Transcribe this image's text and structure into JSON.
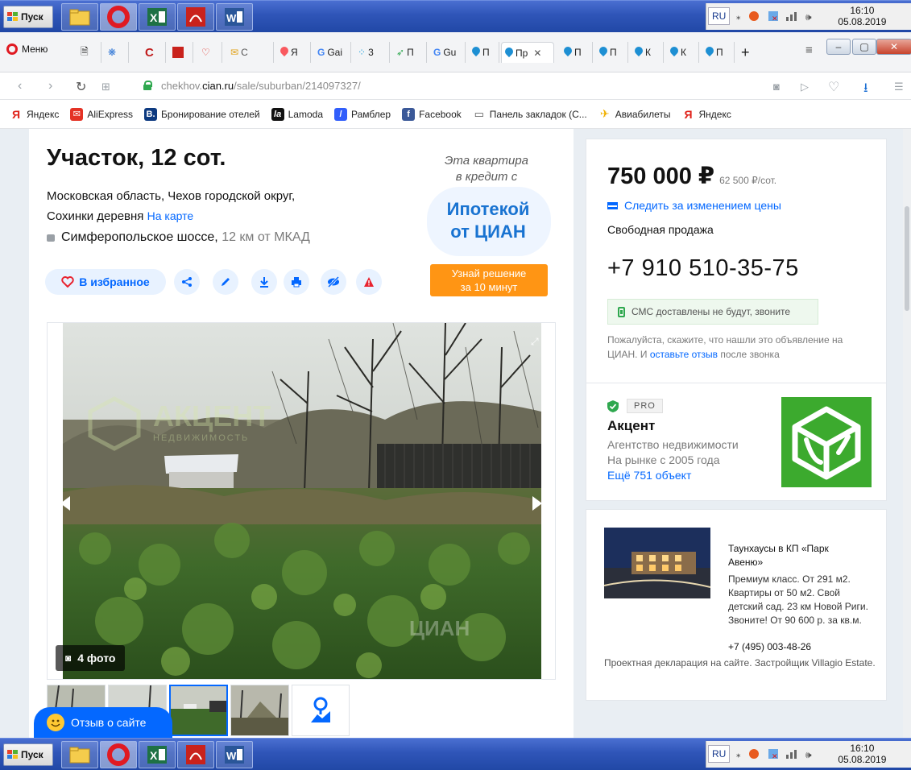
{
  "taskbar": {
    "start_label": "Пуск",
    "lang": "RU",
    "time": "16:10",
    "date": "05.08.2019"
  },
  "browser": {
    "menu_label": "Меню",
    "tabs": [
      "С",
      "Я",
      "Gai",
      "3",
      "П",
      "Gu",
      "П",
      "Пр",
      "П",
      "П",
      "К",
      "К",
      "П"
    ],
    "new_tab": "+",
    "url_prefix": "chekhov.",
    "url_domain": "cian.ru",
    "url_path": "/sale/suburban/214097327/"
  },
  "bookmarks": [
    {
      "label": "Яндекс",
      "icon": "Я",
      "color": "#e0231b"
    },
    {
      "label": "AliExpress",
      "icon": "✉",
      "color": "#e43225"
    },
    {
      "label": "Бронирование отелей",
      "icon": "B.",
      "color": "#0d3a80"
    },
    {
      "label": "Lamoda",
      "icon": "la",
      "color": "#111111"
    },
    {
      "label": "Рамблер",
      "icon": "/",
      "color": "#315efb"
    },
    {
      "label": "Facebook",
      "icon": "f",
      "color": "#3b5998"
    },
    {
      "label": "Панель закладок (С...",
      "icon": "▭",
      "color": "#ffffff"
    },
    {
      "label": "Авиабилеты",
      "icon": "✈",
      "color": "#ffffff"
    },
    {
      "label": "Яндекс",
      "icon": "Я",
      "color": "#e0231b"
    }
  ],
  "listing": {
    "title": "Участок, 12 сот.",
    "address_line1": "Московская область, Чехов городской округ,",
    "address_line2": "Сохинки деревня",
    "map_link": "На карте",
    "highway": "Симферопольское шоссе,",
    "distance": "12 км от МКАД",
    "favorite_label": "В избранное",
    "photo_count": "4 фото"
  },
  "promo": {
    "ask_line1": "Эта квартира",
    "ask_line2": "в кредит с",
    "big_line1": "Ипотекой",
    "big_line2": "от ЦИАН",
    "btn_line1": "Узнай решение",
    "btn_line2": "за 10 минут"
  },
  "watermarks": {
    "agency_word": "АКЦЕНТ",
    "agency_sub": "НЕДВИЖИМОСТЬ",
    "cian": "ЦИАН"
  },
  "sidebar": {
    "price": "750 000 ₽",
    "price_per": "62 500 ₽/сот.",
    "follow_label": "Следить за изменением цены",
    "sale_type": "Свободная продажа",
    "phone": "+7 910 510-35-75",
    "sms_notice": "СМС доставлены не будут, звоните",
    "hint_start": "Пожалуйста, скажите, что нашли это объявление на ЦИАН. И ",
    "hint_link": "оставьте отзыв",
    "hint_end": " после звонка",
    "pro_badge": "PRO",
    "agency_name": "Акцент",
    "agency_type": "Агентство недвижимости",
    "agency_since": "На рынке с 2005 года",
    "agency_more": "Ещё 751 объект"
  },
  "ad": {
    "title": "Таунхаусы в КП «Парк Авеню»",
    "text": "Премиум класс. От 291 м2. Квартиры от 50 м2. Свой детский сад. 23 км Новой Риги. Звоните! От 90 600 р. за кв.м.",
    "phone": "+7 (495) 003-48-26",
    "footer": "Проектная декларация на сайте. Застройщик Villagio Estate."
  },
  "review_button": "Отзыв о сайте",
  "colors": {
    "accent": "#0468ff",
    "promo_orange": "#ff9514",
    "agency_green": "#3caa2e"
  }
}
